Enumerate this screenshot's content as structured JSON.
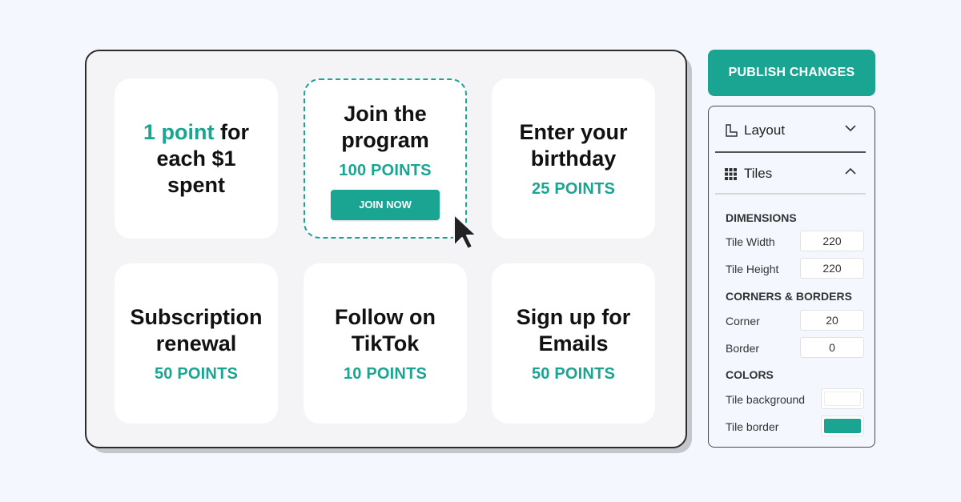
{
  "tiles": [
    {
      "title_accent": "1 point",
      "title_line1_rest": " for",
      "title_line2": "each $1",
      "title_line3": "spent"
    },
    {
      "title_line1": "Join the",
      "title_line2": "program",
      "points": "100 POINTS",
      "button": "JOIN NOW"
    },
    {
      "title_line1": "Enter your",
      "title_line2": "birthday",
      "points": "25 POINTS"
    },
    {
      "title_line1": "Subscription",
      "title_line2": "renewal",
      "points": "50 POINTS"
    },
    {
      "title_line1": "Follow on",
      "title_line2": "TikTok",
      "points": "10 POINTS"
    },
    {
      "title_line1": "Sign up for",
      "title_line2": "Emails",
      "points": "50 POINTS"
    }
  ],
  "toolbar": {
    "publish_label": "PUBLISH CHANGES"
  },
  "panel": {
    "layout_label": "Layout",
    "tiles_label": "Tiles",
    "dimensions": {
      "heading": "DIMENSIONS",
      "tile_width_label": "Tile Width",
      "tile_width_value": "220",
      "tile_height_label": "Tile Height",
      "tile_height_value": "220"
    },
    "corners_borders": {
      "heading": "CORNERS & BORDERS",
      "corner_label": "Corner",
      "corner_value": "20",
      "border_label": "Border",
      "border_value": "0"
    },
    "colors": {
      "heading": "COLORS",
      "tile_background_label": "Tile background",
      "tile_background_color": "#ffffff",
      "tile_border_label": "Tile border",
      "tile_border_color": "#1aa593"
    }
  },
  "theme": {
    "accent": "#1aa593",
    "page_bg": "#f4f7fe",
    "canvas_bg": "#f4f3f5"
  }
}
